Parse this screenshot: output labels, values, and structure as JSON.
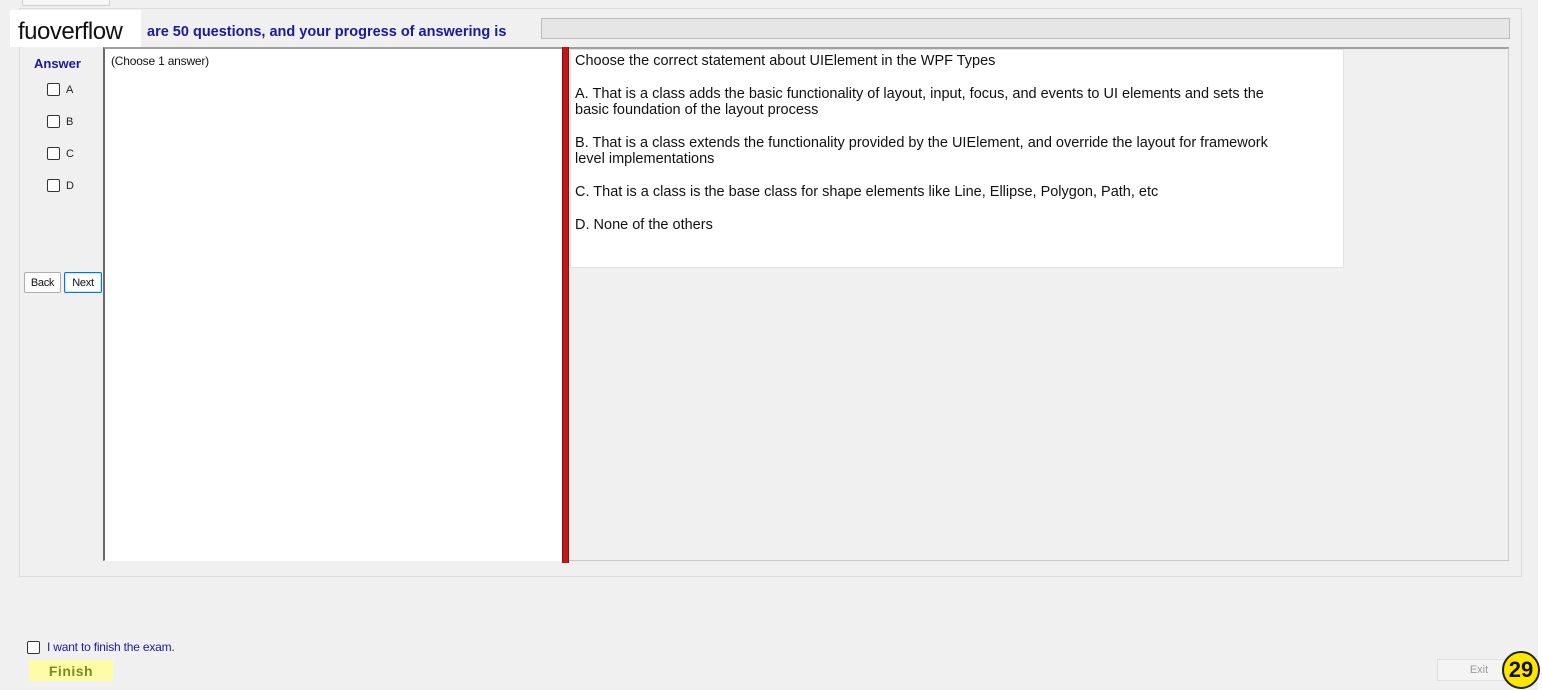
{
  "brand": {
    "name": "fuoverflow"
  },
  "header": {
    "progress_text": "are 50 questions, and your progress of answering is",
    "progress_value": 0
  },
  "answer_panel": {
    "title": "Answer",
    "options": [
      {
        "label": "A",
        "checked": false
      },
      {
        "label": "B",
        "checked": false
      },
      {
        "label": "C",
        "checked": false
      },
      {
        "label": "D",
        "checked": false
      }
    ],
    "hint": "(Choose 1 answer)"
  },
  "nav": {
    "back_label": "Back",
    "next_label": "Next"
  },
  "question": {
    "stem": "Choose the correct statement about UIElement in the WPF Types",
    "choices": [
      "A.  That is a class adds the basic functionality of layout, input, focus, and events to UI elements and sets the basic foundation of the layout process",
      "B.  That is a class extends the functionality provided by the UIElement, and override the layout for framework level implementations",
      "C.  That is a class is the base class for shape elements like Line, Ellipse, Polygon, Path, etc",
      "D.  None of the others"
    ]
  },
  "footer": {
    "finish_check_label": "I want to finish the exam.",
    "finish_label": "Finish",
    "exit_label": "Exit",
    "page_number": "29"
  },
  "colors": {
    "accent_text": "#1a1a9c",
    "splitter": "#c01818",
    "finish_bg": "#fffca8",
    "badge": "#ffe600"
  }
}
